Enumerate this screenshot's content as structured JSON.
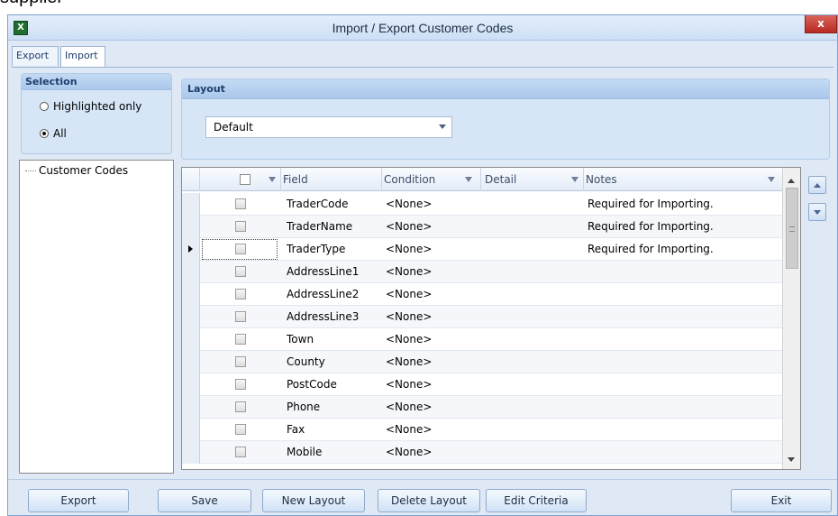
{
  "window": {
    "title": "Import / Export Customer Codes",
    "close_label": "x",
    "app_icon_label": "X"
  },
  "tabs": [
    {
      "label": "Export"
    },
    {
      "label": "Import"
    }
  ],
  "selection": {
    "header": "Selection",
    "options": [
      {
        "label": "Highlighted only",
        "selected": false
      },
      {
        "label": "All",
        "selected": true
      }
    ]
  },
  "tree": {
    "items": [
      {
        "label": "Customer Codes"
      }
    ]
  },
  "layout": {
    "header": "Layout",
    "selected": "Default"
  },
  "grid": {
    "columns": [
      "Field",
      "Condition",
      "Detail",
      "Notes"
    ],
    "rows": [
      {
        "field": "TraderCode",
        "condition": "<None>",
        "detail": "",
        "notes": "Required for Importing."
      },
      {
        "field": "TraderName",
        "condition": "<None>",
        "detail": "",
        "notes": "Required for Importing."
      },
      {
        "field": "TraderType",
        "condition": "<None>",
        "detail": "",
        "notes": "Required for Importing."
      },
      {
        "field": "AddressLine1",
        "condition": "<None>",
        "detail": "",
        "notes": ""
      },
      {
        "field": "AddressLine2",
        "condition": "<None>",
        "detail": "",
        "notes": ""
      },
      {
        "field": "AddressLine3",
        "condition": "<None>",
        "detail": "",
        "notes": ""
      },
      {
        "field": "Town",
        "condition": "<None>",
        "detail": "",
        "notes": ""
      },
      {
        "field": "County",
        "condition": "<None>",
        "detail": "",
        "notes": ""
      },
      {
        "field": "PostCode",
        "condition": "<None>",
        "detail": "",
        "notes": ""
      },
      {
        "field": "Phone",
        "condition": "<None>",
        "detail": "",
        "notes": ""
      },
      {
        "field": "Fax",
        "condition": "<None>",
        "detail": "",
        "notes": ""
      },
      {
        "field": "Mobile",
        "condition": "<None>",
        "detail": "",
        "notes": ""
      }
    ],
    "current_row": 2
  },
  "buttons": {
    "export": "Export",
    "save": "Save",
    "new_layout": "New Layout",
    "delete_layout": "Delete Layout",
    "edit_criteria": "Edit Criteria",
    "exit": "Exit"
  },
  "cut_text": "supplier"
}
